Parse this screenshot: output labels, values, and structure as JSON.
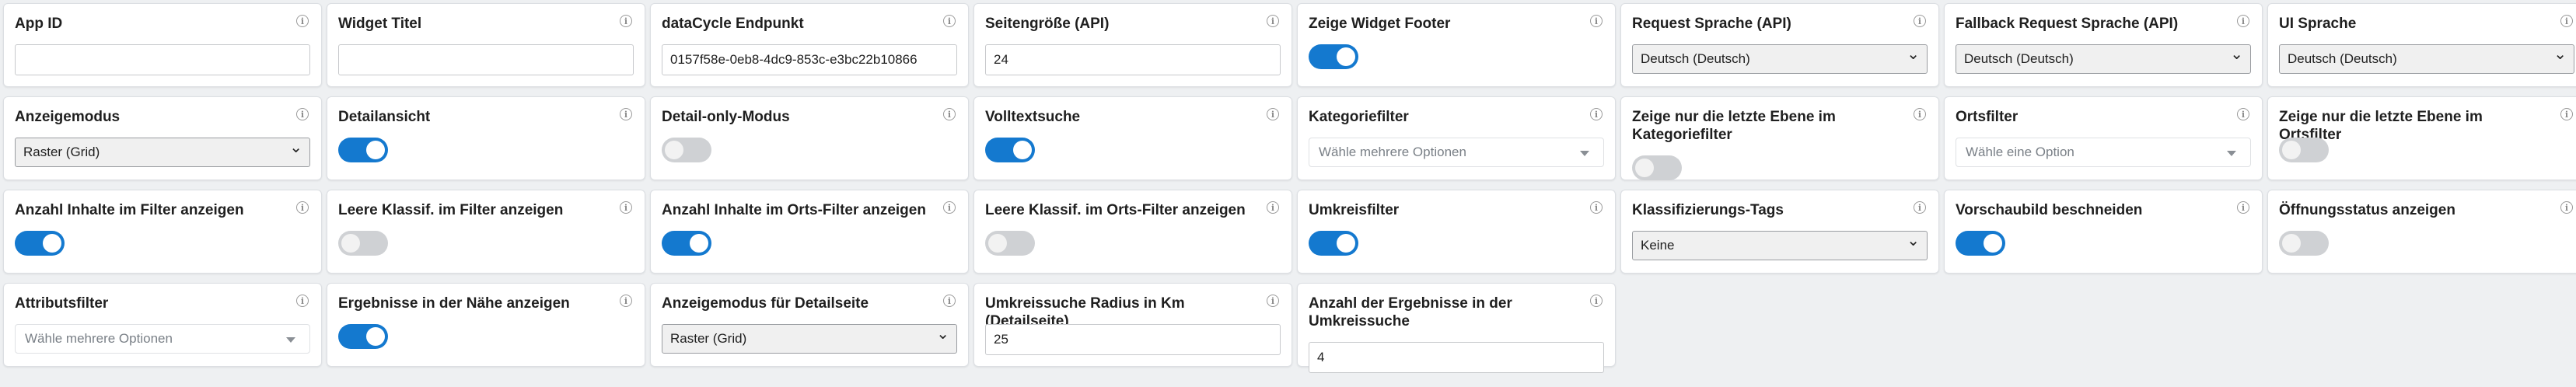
{
  "colors": {
    "toggle_on": "#1479cf",
    "toggle_off": "#cfd1d4"
  },
  "fields": [
    {
      "key": "app-id",
      "label": "App ID",
      "type": "text",
      "value": ""
    },
    {
      "key": "widget-titel",
      "label": "Widget Titel",
      "type": "text",
      "value": ""
    },
    {
      "key": "datacycle-endpunkt",
      "label": "dataCycle Endpunkt",
      "type": "text",
      "value": "0157f58e-0eb8-4dc9-853c-e3bc22b10866"
    },
    {
      "key": "seitengroesse",
      "label": "Seitengröße (API)",
      "type": "text",
      "value": "24"
    },
    {
      "key": "widget-footer",
      "label": "Zeige Widget Footer",
      "type": "toggle",
      "checked": true
    },
    {
      "key": "request-sprache",
      "label": "Request Sprache (API)",
      "type": "select",
      "value": "Deutsch (Deutsch)"
    },
    {
      "key": "fallback-sprache",
      "label": "Fallback Request Sprache (API)",
      "type": "select",
      "value": "Deutsch (Deutsch)"
    },
    {
      "key": "ui-sprache",
      "label": "UI Sprache",
      "type": "select",
      "value": "Deutsch (Deutsch)"
    },
    {
      "key": "anzeigemodus",
      "label": "Anzeigemodus",
      "type": "select",
      "value": "Raster (Grid)"
    },
    {
      "key": "detailansicht",
      "label": "Detailansicht",
      "type": "toggle",
      "checked": true
    },
    {
      "key": "detail-only",
      "label": "Detail-only-Modus",
      "type": "toggle",
      "checked": false
    },
    {
      "key": "volltextsuche",
      "label": "Volltextsuche",
      "type": "toggle",
      "checked": true
    },
    {
      "key": "kategoriefilter",
      "label": "Kategoriefilter",
      "type": "multi",
      "placeholder": "Wähle mehrere Optionen"
    },
    {
      "key": "letzte-ebene-kategorie",
      "label": "Zeige nur die letzte Ebene im Kategoriefilter",
      "type": "toggle",
      "checked": false,
      "wrap": true
    },
    {
      "key": "ortsfilter",
      "label": "Ortsfilter",
      "type": "multi",
      "placeholder": "Wähle eine Option"
    },
    {
      "key": "letzte-ebene-ort",
      "label": "Zeige nur die letzte Ebene im Ortsfilter",
      "type": "toggle",
      "checked": false
    },
    {
      "key": "anzahl-filter",
      "label": "Anzahl Inhalte im Filter anzeigen",
      "type": "toggle",
      "checked": true
    },
    {
      "key": "leere-klassif",
      "label": "Leere Klassif. im Filter anzeigen",
      "type": "toggle",
      "checked": false
    },
    {
      "key": "anzahl-orts-filter",
      "label": "Anzahl Inhalte im Orts-Filter anzeigen",
      "type": "toggle",
      "checked": true
    },
    {
      "key": "leere-klassif-ort",
      "label": "Leere Klassif. im Orts-Filter anzeigen",
      "type": "toggle",
      "checked": false
    },
    {
      "key": "umkreisfilter",
      "label": "Umkreisfilter",
      "type": "toggle",
      "checked": true
    },
    {
      "key": "klassifizierungs-tags",
      "label": "Klassifizierungs-Tags",
      "type": "select",
      "value": "Keine"
    },
    {
      "key": "vorschaubild",
      "label": "Vorschaubild beschneiden",
      "type": "toggle",
      "checked": true
    },
    {
      "key": "oeffnungsstatus",
      "label": "Öffnungsstatus anzeigen",
      "type": "toggle",
      "checked": false
    },
    {
      "key": "attributsfilter",
      "label": "Attributsfilter",
      "type": "multi",
      "placeholder": "Wähle mehrere Optionen"
    },
    {
      "key": "ergebnisse-naehe",
      "label": "Ergebnisse in der Nähe anzeigen",
      "type": "toggle",
      "checked": true
    },
    {
      "key": "anzeigemodus-detail",
      "label": "Anzeigemodus für Detailseite",
      "type": "select",
      "value": "Raster (Grid)"
    },
    {
      "key": "umkreissuche-radius",
      "label": "Umkreissuche Radius in Km (Detailseite)",
      "type": "text",
      "value": "25"
    },
    {
      "key": "anzahl-ergebnisse-umkreis",
      "label": "Anzahl der Ergebnisse in der Umkreissuche",
      "type": "text",
      "value": "4",
      "wrap": true
    }
  ]
}
